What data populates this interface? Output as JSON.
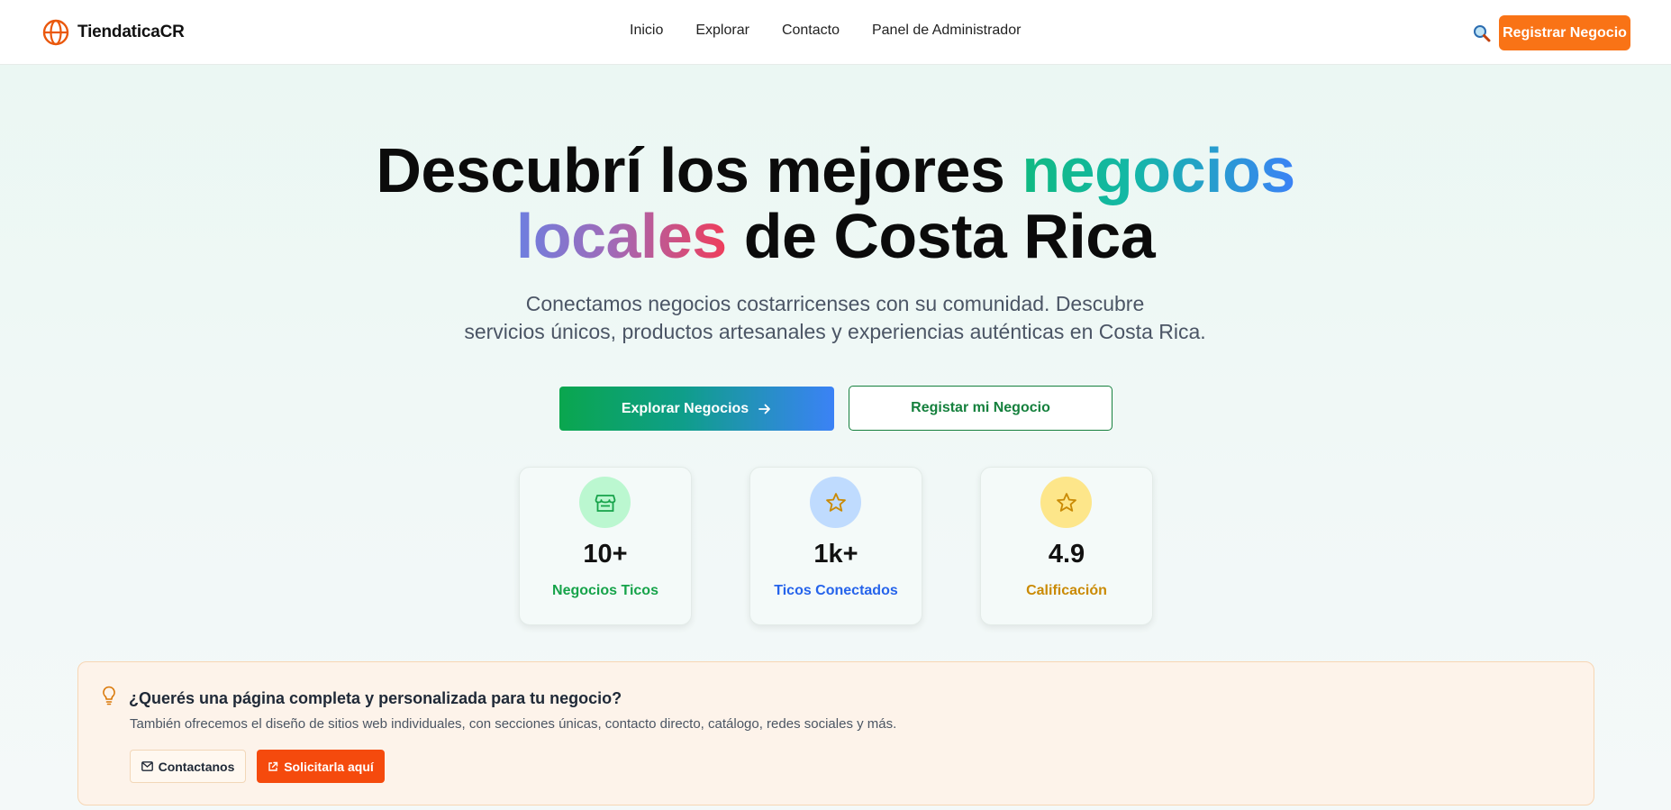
{
  "header": {
    "brand": "TiendaticaCR",
    "nav": [
      "Inicio",
      "Explorar",
      "Contacto",
      "Panel de Administrador"
    ],
    "register_label": "Registrar Negocio",
    "accent": "#f97316"
  },
  "hero": {
    "title_part1": "Descubrí los mejores ",
    "title_highlight1": "negocios",
    "title_highlight2": "locales",
    "title_part2": " de Costa Rica",
    "subtitle_line1": "Conectamos negocios costarricenses con su comunidad. Descubre",
    "subtitle_line2": "servicios únicos, productos artesanales y experiencias auténticas en Costa Rica.",
    "explore_label": "Explorar Negocios",
    "register_label": "Registar mi Negocio"
  },
  "stats": [
    {
      "value": "10+",
      "label": "Negocios Ticos",
      "icon": "store-icon",
      "color": "#16a34a",
      "bg": "#bbf7d0"
    },
    {
      "value": "1k+",
      "label": "Ticos Conectados",
      "icon": "star-icon",
      "color": "#2563eb",
      "bg": "#bfdbfe"
    },
    {
      "value": "4.9",
      "label": "Calificación",
      "icon": "star-icon",
      "color": "#ca8a04",
      "bg": "#fde68a"
    }
  ],
  "promo": {
    "title": "¿Querés una página completa y personalizada para tu negocio?",
    "description": "También ofrecemos el diseño de sitios web individuales, con secciones únicas, contacto directo, catálogo, redes sociales y más.",
    "contact_label": "Contactanos",
    "request_label": "Solicitarla aquí"
  }
}
